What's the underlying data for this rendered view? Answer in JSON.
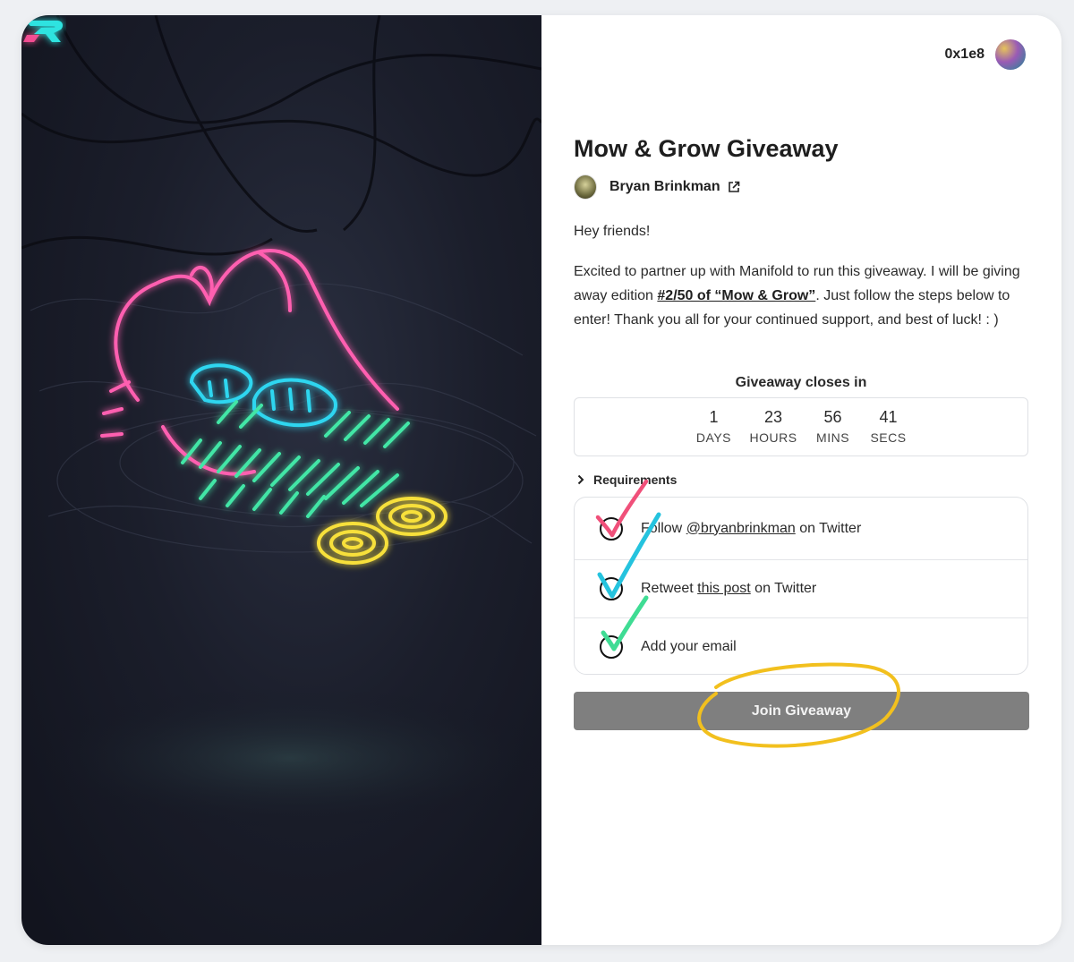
{
  "wallet": {
    "address": "0x1e8"
  },
  "giveaway": {
    "title": "Mow & Grow Giveaway",
    "creator_name": "Bryan Brinkman",
    "greeting": "Hey friends!",
    "body_start": "Excited to partner up with Manifold to run this giveaway. I will be giving away edition ",
    "body_link": "#2/50 of “Mow & Grow”",
    "body_end": ". Just follow the steps below to enter! Thank you all for your continued support, and best of luck! : )"
  },
  "countdown": {
    "heading": "Giveaway closes in",
    "units": [
      {
        "value": "1",
        "label": "DAYS"
      },
      {
        "value": "23",
        "label": "HOURS"
      },
      {
        "value": "56",
        "label": "MINS"
      },
      {
        "value": "41",
        "label": "SECS"
      }
    ]
  },
  "requirements": {
    "toggle_label": "Requirements",
    "items": [
      {
        "prefix": "Follow ",
        "link": "@bryanbrinkman",
        "suffix": " on Twitter"
      },
      {
        "prefix": "Retweet ",
        "link": "this post",
        "suffix": " on Twitter"
      },
      {
        "prefix": "Add your email",
        "link": "",
        "suffix": ""
      }
    ]
  },
  "join_button": {
    "label": "Join Giveaway"
  },
  "colors": {
    "brand_accent": "#2fe3e0",
    "check_pink": "#f0507a",
    "check_cyan": "#25c3de",
    "check_green": "#3fdc94",
    "circle_yellow": "#f2c01e",
    "button_gray": "#7f7f7f"
  },
  "icons": {
    "logo": "manifold-logo-icon",
    "external_link": "external-link-icon",
    "chevron": "chevron-right-icon"
  }
}
